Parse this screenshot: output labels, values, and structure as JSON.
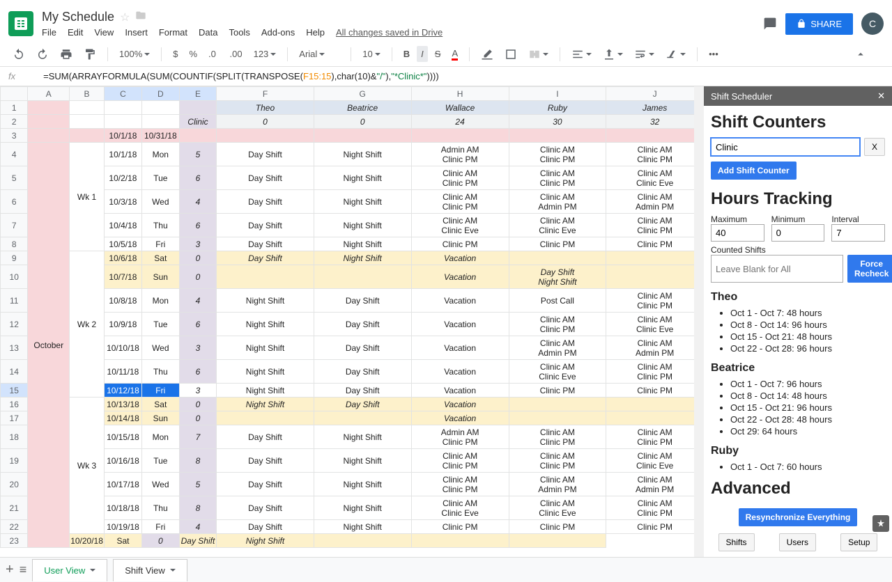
{
  "doc": {
    "title": "My Schedule",
    "savenote": "All changes saved in Drive",
    "avatar": "C"
  },
  "menu": [
    "File",
    "Edit",
    "View",
    "Insert",
    "Format",
    "Data",
    "Tools",
    "Add-ons",
    "Help"
  ],
  "share": "SHARE",
  "toolbar": {
    "zoom": "100%",
    "font": "Arial",
    "size": "10",
    "number_fmt": "123"
  },
  "formula": {
    "pre": "=SUM(ARRAYFORMULA(SUM(COUNTIF(SPLIT(TRANSPOSE(",
    "ref": "F15:15",
    "mid1": "),char(10)&",
    "str1": "\"/\"",
    "mid2": "),",
    "str2": "\"*Clinic*\"",
    "post": "))))"
  },
  "cols": [
    "A",
    "B",
    "C",
    "D",
    "E",
    "F",
    "G",
    "H",
    "I",
    "J"
  ],
  "header_names": [
    "Theo",
    "Beatrice",
    "Wallace",
    "Ruby",
    "James"
  ],
  "header_counts": [
    "0",
    "0",
    "24",
    "30",
    "32"
  ],
  "header_celabel": "Clinic",
  "month": "October",
  "date_range": [
    "10/1/18",
    "10/31/18"
  ],
  "weeks": [
    "Wk 1",
    "Wk 2",
    "Wk 3"
  ],
  "rows": [
    {
      "n": 4,
      "d": "10/1/18",
      "dow": "Mon",
      "cnt": "5",
      "c": [
        "Day Shift",
        "Night Shift",
        "Admin AM\nClinic PM",
        "Clinic AM\nClinic PM",
        "Clinic AM\nClinic PM"
      ]
    },
    {
      "n": 5,
      "d": "10/2/18",
      "dow": "Tue",
      "cnt": "6",
      "c": [
        "Day Shift",
        "Night Shift",
        "Clinic AM\nClinic PM",
        "Clinic AM\nClinic PM",
        "Clinic AM\nClinic Eve"
      ]
    },
    {
      "n": 6,
      "d": "10/3/18",
      "dow": "Wed",
      "cnt": "4",
      "c": [
        "Day Shift",
        "Night Shift",
        "Clinic AM\nClinic PM",
        "Clinic AM\nAdmin PM",
        "Clinic AM\nAdmin PM"
      ]
    },
    {
      "n": 7,
      "d": "10/4/18",
      "dow": "Thu",
      "cnt": "6",
      "c": [
        "Day Shift",
        "Night Shift",
        "Clinic AM\nClinic Eve",
        "Clinic AM\nClinic Eve",
        "Clinic AM\nClinic PM"
      ]
    },
    {
      "n": 8,
      "d": "10/5/18",
      "dow": "Fri",
      "cnt": "3",
      "c": [
        "Day Shift",
        "Night Shift",
        "Clinic PM",
        "Clinic PM",
        "Clinic PM"
      ],
      "short": true
    },
    {
      "n": 9,
      "d": "10/6/18",
      "dow": "Sat",
      "cnt": "0",
      "c": [
        "Day Shift",
        "Night Shift",
        "Vacation",
        "",
        ""
      ],
      "bg": "cream",
      "short": true,
      "italic": true
    },
    {
      "n": 10,
      "d": "10/7/18",
      "dow": "Sun",
      "cnt": "0",
      "c": [
        "",
        "",
        "Vacation",
        "Day Shift\nNight Shift",
        ""
      ],
      "bg": "cream",
      "short": false,
      "italic": true
    },
    {
      "n": 11,
      "d": "10/8/18",
      "dow": "Mon",
      "cnt": "4",
      "c": [
        "Night Shift",
        "Day Shift",
        "Vacation",
        "Post Call",
        "Clinic AM\nClinic PM"
      ]
    },
    {
      "n": 12,
      "d": "10/9/18",
      "dow": "Tue",
      "cnt": "6",
      "c": [
        "Night Shift",
        "Day Shift",
        "Vacation",
        "Clinic AM\nClinic PM",
        "Clinic AM\nClinic Eve"
      ]
    },
    {
      "n": 13,
      "d": "10/10/18",
      "dow": "Wed",
      "cnt": "3",
      "c": [
        "Night Shift",
        "Day Shift",
        "Vacation",
        "Clinic AM\nAdmin PM",
        "Clinic AM\nAdmin PM"
      ]
    },
    {
      "n": 14,
      "d": "10/11/18",
      "dow": "Thu",
      "cnt": "6",
      "c": [
        "Night Shift",
        "Day Shift",
        "Vacation",
        "Clinic AM\nClinic Eve",
        "Clinic AM\nClinic PM"
      ]
    },
    {
      "n": 15,
      "d": "10/12/18",
      "dow": "Fri",
      "cnt": "3",
      "c": [
        "Night Shift",
        "Day Shift",
        "Vacation",
        "Clinic PM",
        "Clinic PM"
      ],
      "short": true,
      "sel": true
    },
    {
      "n": 16,
      "d": "10/13/18",
      "dow": "Sat",
      "cnt": "0",
      "c": [
        "Night Shift",
        "Day Shift",
        "Vacation",
        "",
        ""
      ],
      "bg": "cream",
      "short": true,
      "italic": true
    },
    {
      "n": 17,
      "d": "10/14/18",
      "dow": "Sun",
      "cnt": "0",
      "c": [
        "",
        "",
        "Vacation",
        "",
        ""
      ],
      "bg": "cream",
      "short": true,
      "italic": true
    },
    {
      "n": 18,
      "d": "10/15/18",
      "dow": "Mon",
      "cnt": "7",
      "c": [
        "Day Shift",
        "Night Shift",
        "Admin AM\nClinic PM",
        "Clinic AM\nClinic PM",
        "Clinic AM\nClinic PM"
      ]
    },
    {
      "n": 19,
      "d": "10/16/18",
      "dow": "Tue",
      "cnt": "8",
      "c": [
        "Day Shift",
        "Night Shift",
        "Clinic AM\nClinic PM",
        "Clinic AM\nClinic PM",
        "Clinic AM\nClinic Eve"
      ]
    },
    {
      "n": 20,
      "d": "10/17/18",
      "dow": "Wed",
      "cnt": "5",
      "c": [
        "Day Shift",
        "Night Shift",
        "Clinic AM\nClinic PM",
        "Clinic AM\nAdmin PM",
        "Clinic AM\nAdmin PM"
      ]
    },
    {
      "n": 21,
      "d": "10/18/18",
      "dow": "Thu",
      "cnt": "8",
      "c": [
        "Day Shift",
        "Night Shift",
        "Clinic AM\nClinic Eve",
        "Clinic AM\nClinic Eve",
        "Clinic AM\nClinic PM"
      ]
    },
    {
      "n": 22,
      "d": "10/19/18",
      "dow": "Fri",
      "cnt": "4",
      "c": [
        "Day Shift",
        "Night Shift",
        "Clinic PM",
        "Clinic PM",
        "Clinic PM"
      ],
      "short": true
    },
    {
      "n": 23,
      "d": "10/20/18",
      "dow": "Sat",
      "cnt": "0",
      "c": [
        "Day Shift",
        "Night Shift",
        "",
        "",
        ""
      ],
      "bg": "cream",
      "short": true,
      "italic": true
    }
  ],
  "tabs": [
    "User View",
    "Shift View"
  ],
  "sidebar": {
    "title": "Shift Scheduler",
    "h1": "Shift Counters",
    "counter_input": "Clinic",
    "x": "X",
    "add": "Add Shift Counter",
    "h2": "Hours Tracking",
    "max_l": "Maximum",
    "max_v": "40",
    "min_l": "Minimum",
    "min_v": "0",
    "int_l": "Interval",
    "int_v": "7",
    "counted_l": "Counted Shifts",
    "counted_ph": "Leave Blank for All",
    "recheck": "Force Recheck",
    "people": [
      {
        "name": "Theo",
        "items": [
          "Oct 1 - Oct 7: 48 hours",
          "Oct 8 - Oct 14: 96 hours",
          "Oct 15 - Oct 21: 48 hours",
          "Oct 22 - Oct 28: 96 hours"
        ]
      },
      {
        "name": "Beatrice",
        "items": [
          "Oct 1 - Oct 7: 96 hours",
          "Oct 8 - Oct 14: 48 hours",
          "Oct 15 - Oct 21: 96 hours",
          "Oct 22 - Oct 28: 48 hours",
          "Oct 29: 64 hours"
        ]
      },
      {
        "name": "Ruby",
        "items": [
          "Oct 1 - Oct 7: 60 hours"
        ]
      }
    ],
    "advanced": "Advanced",
    "resync": "Resynchronize Everything",
    "btns": [
      "Shifts",
      "Users",
      "Setup"
    ]
  }
}
